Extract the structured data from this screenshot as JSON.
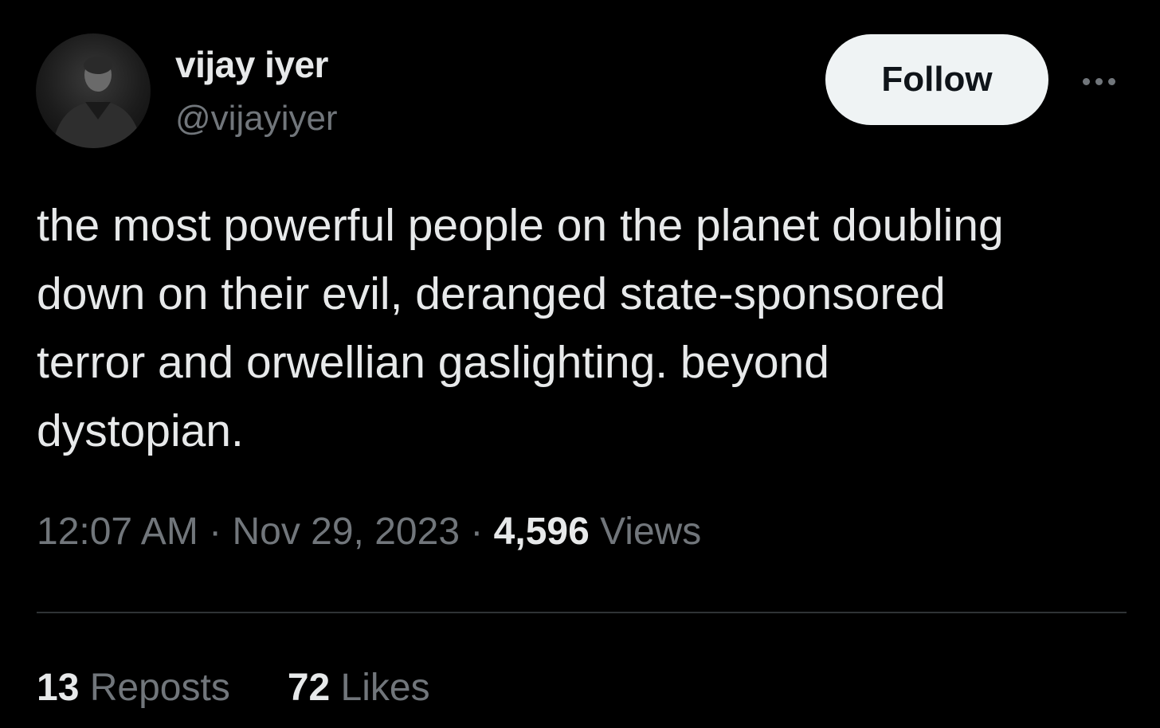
{
  "author": {
    "display_name": "vijay iyer",
    "handle": "@vijayiyer"
  },
  "actions": {
    "follow_label": "Follow",
    "more_icon": "more-horizontal-icon"
  },
  "tweet": {
    "lines": [
      "the most powerful people on the planet doubling",
      "down on their evil, deranged state-sponsored",
      "terror and orwellian gaslighting. beyond",
      "dystopian."
    ]
  },
  "meta": {
    "time": "12:07 AM",
    "sep1": " · ",
    "date": "Nov 29, 2023",
    "sep2": " · ",
    "views_count": "4,596",
    "views_label": " Views"
  },
  "stats": {
    "reposts_count": "13",
    "reposts_label": " Reposts",
    "likes_count": "72",
    "likes_label": " Likes"
  },
  "colors": {
    "background": "#000000",
    "primary_text": "#e7e9ea",
    "secondary_text": "#71767b",
    "divider": "#2f3336",
    "follow_bg": "#eff3f4",
    "follow_text": "#0f1419"
  }
}
